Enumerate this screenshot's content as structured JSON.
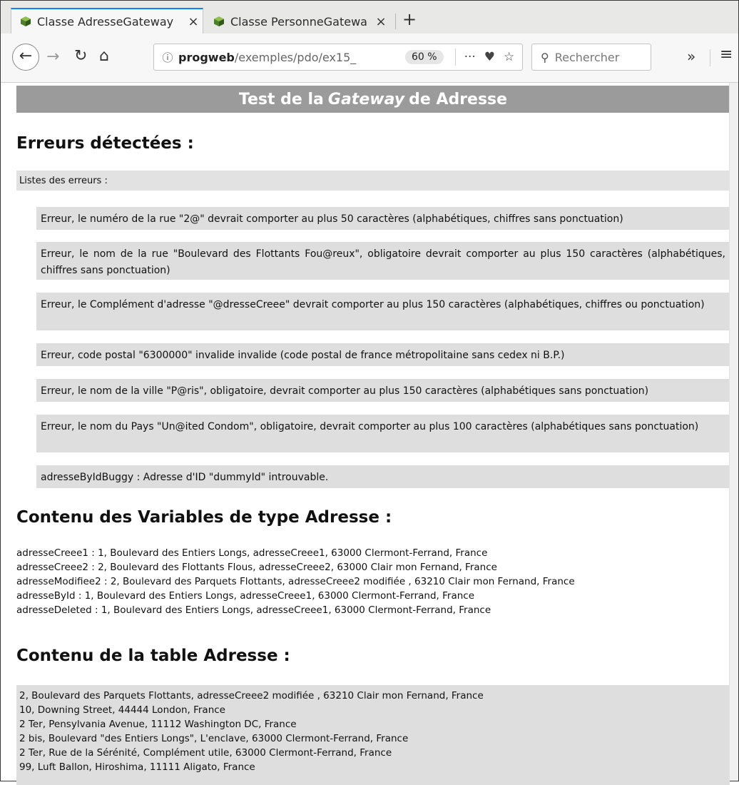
{
  "browser": {
    "tabs": [
      {
        "title": "Classe AdresseGateway",
        "active": true
      },
      {
        "title": "Classe PersonneGatewa",
        "active": false
      }
    ],
    "url_host": "progweb",
    "url_path": "/exemples/pdo/ex15_",
    "zoom": "60 %",
    "search_placeholder": "Rechercher"
  },
  "page": {
    "banner_prefix": "Test de la",
    "banner_em": "Gateway",
    "banner_suffix": "de Adresse",
    "errors_title": "Erreurs détectées :",
    "errors_list_label": "Listes des erreurs :",
    "errors": [
      "Erreur, le numéro de la rue \"2@\" devrait comporter au plus 50 caractères (alphabétiques, chiffres sans ponctuation)",
      "Erreur, le nom de la rue \"Boulevard des Flottants Fou@reux\", obligatoire devrait comporter au plus 150 caractères (alphabétiques, chiffres sans ponctuation)",
      "Erreur, le Complément d'adresse \"@dresseCreee\" devrait comporter au plus 150 caractères (alphabétiques, chiffres ou ponctuation)",
      "Erreur, code postal \"6300000\" invalide invalide (code postal de france métropolitaine sans cedex ni B.P.)",
      "Erreur, le nom de la ville \"P@ris\", obligatoire, devrait comporter au plus 150 caractères (alphabétiques sans ponctuation)",
      "Erreur, le nom du Pays \"Un@ited Condom\", obligatoire, devrait comporter au plus 100 caractères (alphabétiques sans ponctuation)",
      "adresseByIdBuggy : Adresse d'ID \"dummyId\" introuvable."
    ],
    "vars_title": "Contenu des Variables de type Adresse :",
    "vars": [
      "adresseCreee1 : 1, Boulevard des Entiers Longs, adresseCreee1, 63000 Clermont-Ferrand, France",
      "adresseCreee2 : 2, Boulevard des Flottants Flous, adresseCreee2, 63000 Clair mon Fernand, France",
      "adresseModifiee2 : 2, Boulevard des Parquets Flottants, adresseCreee2 modifiée , 63210 Clair mon Fernand, France",
      "adresseById : 1, Boulevard des Entiers Longs, adresseCreee1, 63000 Clermont-Ferrand, France",
      "adresseDeleted : 1, Boulevard des Entiers Longs, adresseCreee1, 63000 Clermont-Ferrand, France"
    ],
    "table_title": "Contenu de la table Adresse :",
    "table_rows": [
      "2, Boulevard des Parquets Flottants, adresseCreee2 modifiée , 63210 Clair mon Fernand, France",
      "10, Downing Street, 44444 London, France",
      "2 Ter, Pensylvania Avenue, 11112 Washington DC, France",
      "2 bis, Boulevard \"des Entiers Longs\", L'enclave, 63000 Clermont-Ferrand, France",
      "2 Ter, Rue de la Sérénité, Complément utile, 63000 Clermont-Ferrand, France",
      "99, Luft Ballon, Hiroshima, 11111 Aligato, France"
    ]
  }
}
